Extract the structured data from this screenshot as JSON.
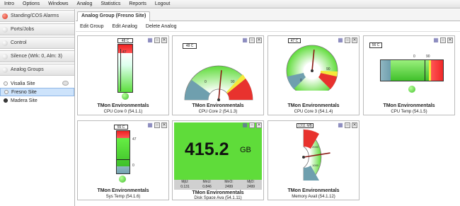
{
  "menu": [
    "Intro",
    "Options",
    "Windows",
    "Analog",
    "Statistics",
    "Reports",
    "Logout"
  ],
  "sidebar": {
    "panels": [
      {
        "label": "Standing/COS Alarms",
        "color": "#e24b3a"
      },
      {
        "label": "Ports/Jobs",
        "color": "#d9d9d9"
      },
      {
        "label": "Control",
        "color": "#d9d9d9"
      },
      {
        "label": "Silence (Wrk: 0, Alm: 3)",
        "color": "#d9d9d9"
      },
      {
        "label": "Analog Groups",
        "color": "#d9d9d9"
      }
    ],
    "items": [
      {
        "label": "Visalia Site",
        "color": "#f2f2f2"
      },
      {
        "label": "Fresno Site",
        "color": "#f2f2f2"
      },
      {
        "label": "Madera Site",
        "color": "#444444"
      }
    ]
  },
  "tab": {
    "label": "Analog Group (Fresno Site)"
  },
  "toolbar": {
    "edit_group": "Edit Group",
    "edit_analog": "Edit Analog",
    "delete_analog": "Delete Analog"
  },
  "widgets": {
    "w1": {
      "title": "TMon Environmentals",
      "sub": "CPU Core 0 (54.1.1)",
      "value": "48 C",
      "tick": "47",
      "level": 0.48
    },
    "w2": {
      "title": "TMon Environmentals",
      "sub": "CPU Core 2 (54.1.3)",
      "value": "48 C",
      "min": "0",
      "max": "90",
      "level": 0.53
    },
    "w3": {
      "title": "TMon Environmentals",
      "sub": "CPU Core 3 (54.1.4)",
      "value": "47 C",
      "min": "0",
      "max": "90",
      "level": 0.52
    },
    "w4": {
      "title": "TMon Environmentals",
      "sub": "CPU Temp (54.1.5)",
      "value": "56 C",
      "min": "0",
      "max": "90",
      "level": 0.62
    },
    "w5": {
      "title": "TMon Environmentals",
      "sub": "Sys Temp (54.1.6)",
      "value": "55 C",
      "tick": "47",
      "tick_low": "0",
      "level": 0.55
    },
    "w6": {
      "title": "TMon Environmentals",
      "sub": "Disk Space Ava (54.1.11)",
      "value": "415.2",
      "unit": "GB",
      "stats": [
        {
          "k": "MjU:",
          "v": "0.131"
        },
        {
          "k": "MnU:",
          "v": "0.846"
        },
        {
          "k": "MnO:",
          "v": "2499"
        },
        {
          "k": "MjO:",
          "v": "2499"
        }
      ]
    },
    "w7": {
      "title": "TMon Environmentals",
      "sub": "Memory Avail (54.1.12)",
      "value": "1311 MB",
      "tick_hi": "2000",
      "tick_mid": "1000",
      "level": 0.45
    }
  },
  "colors": {
    "green": "#5fdc3a",
    "red": "#e8322e",
    "yellow": "#f5e83a",
    "blue": "#6f9fae"
  }
}
